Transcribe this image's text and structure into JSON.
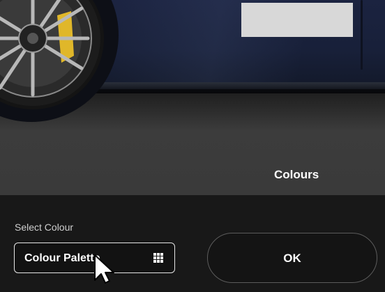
{
  "scene": {
    "title": "Colours",
    "car_color": "#1b2340",
    "caliper_color": "#e0b72a"
  },
  "panel": {
    "select_label": "Select Colour",
    "palette_button_label": "Colour Palette",
    "palette_button_icon": "grid-icon",
    "ok_label": "OK"
  },
  "cursor": {
    "icon": "mouse-pointer-icon"
  }
}
